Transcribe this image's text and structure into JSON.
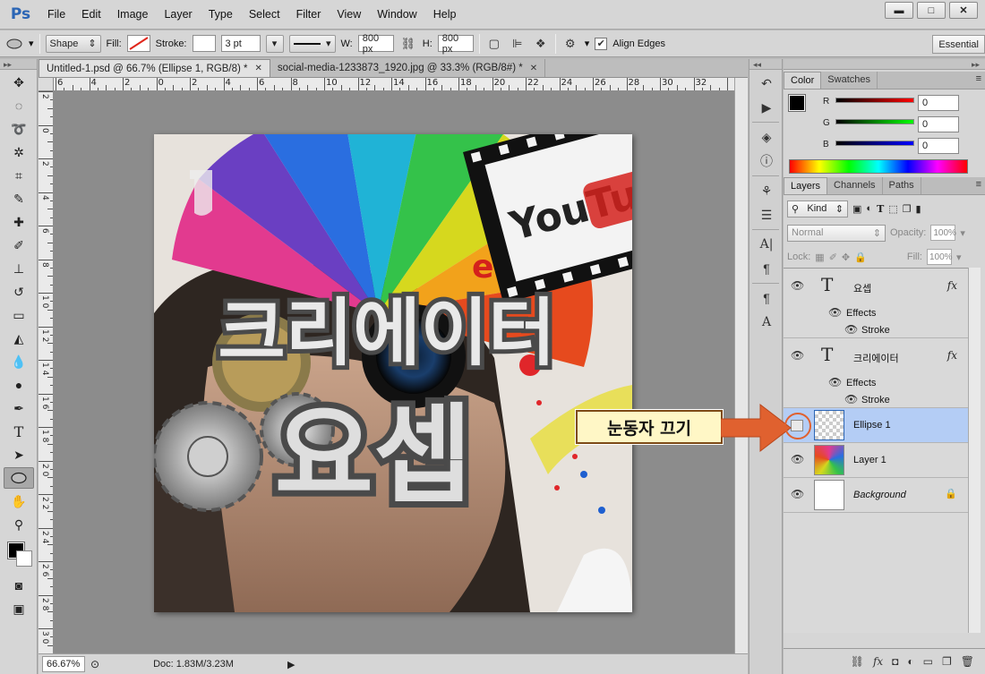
{
  "app": {
    "logo": "Ps"
  },
  "menu": [
    "File",
    "Edit",
    "Image",
    "Layer",
    "Type",
    "Select",
    "Filter",
    "View",
    "Window",
    "Help"
  ],
  "window_controls": {
    "minimize": "▬",
    "maximize": "□",
    "close": "✕"
  },
  "options": {
    "mode": "Shape",
    "fill_label": "Fill:",
    "stroke_label": "Stroke:",
    "stroke_width": "3 pt",
    "w_label": "W:",
    "w_value": "800 px",
    "h_label": "H:",
    "h_value": "800 px",
    "align_edges": "Align Edges",
    "workspace": "Essential"
  },
  "doc_tabs": [
    {
      "title": "Untitled-1.psd @ 66.7% (Ellipse 1, RGB/8) *",
      "active": true
    },
    {
      "title": "social-media-1233873_1920.jpg @ 33.3% (RGB/8#) *",
      "active": false
    }
  ],
  "ruler_top": [
    "6",
    "4",
    "2",
    "0",
    "2",
    "4",
    "6",
    "8",
    "10",
    "12",
    "14",
    "16",
    "18",
    "20",
    "22",
    "24",
    "26",
    "28",
    "30",
    "32"
  ],
  "ruler_left": [
    "2",
    "0",
    "2",
    "4",
    "6",
    "8",
    "1 0",
    "1 2",
    "1 4",
    "1 6",
    "1 8",
    "2 0",
    "2 2",
    "2 4",
    "2 6",
    "2 8",
    "3 0"
  ],
  "status": {
    "zoom": "66.67%",
    "doc": "Doc: 1.83M/3.23M"
  },
  "artwork": {
    "text_top": "크리에이터",
    "text_bottom": "요셉",
    "youtube": "YouTu",
    "youtube_e": "e"
  },
  "color_panel": {
    "tabs": [
      "Color",
      "Swatches"
    ],
    "r_label": "R",
    "r_value": "0",
    "g_label": "G",
    "g_value": "0",
    "b_label": "B",
    "b_value": "0"
  },
  "layers_panel": {
    "tabs": [
      "Layers",
      "Channels",
      "Paths"
    ],
    "kind": "Kind",
    "blend": "Normal",
    "opacity_label": "Opacity:",
    "opacity_value": "100%",
    "lock_label": "Lock:",
    "fill_label": "Fill:",
    "fill_value": "100%",
    "layers": [
      {
        "name": "요셉",
        "type": "text",
        "effects": "Effects",
        "stroke": "Stroke"
      },
      {
        "name": "크리에이터",
        "type": "text",
        "effects": "Effects",
        "stroke": "Stroke"
      },
      {
        "name": "Ellipse 1",
        "type": "shape"
      },
      {
        "name": "Layer 1",
        "type": "image"
      },
      {
        "name": "Background",
        "type": "background"
      }
    ],
    "fx": "fx"
  },
  "callout": {
    "text": "눈동자 끄기"
  },
  "colors": {
    "accent_orange": "#e0612f",
    "selection_blue": "#b4cdf5",
    "ps_blue": "#2b65b5"
  }
}
